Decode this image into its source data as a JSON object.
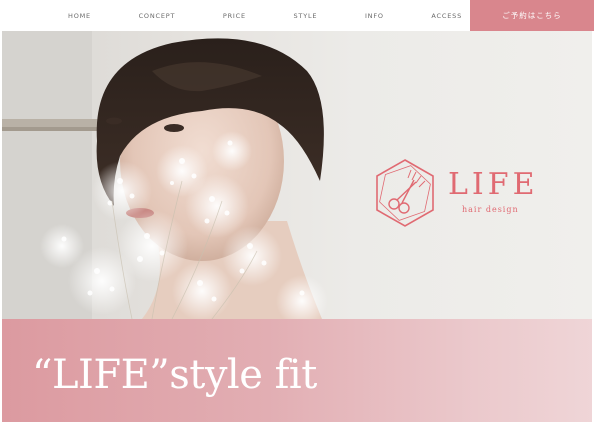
{
  "nav": {
    "items": [
      {
        "label": "HOME"
      },
      {
        "label": "CONCEPT"
      },
      {
        "label": "PRICE"
      },
      {
        "label": "STYLE"
      },
      {
        "label": "INFO"
      },
      {
        "label": "ACCESS"
      }
    ],
    "reserve_label": "ご予約はこちら"
  },
  "brand": {
    "name": "LIFE",
    "subtitle": "hair design",
    "color": "#e06a72"
  },
  "banner": {
    "tagline": "“LIFE”style fit",
    "accent": "#dc9aa0"
  }
}
